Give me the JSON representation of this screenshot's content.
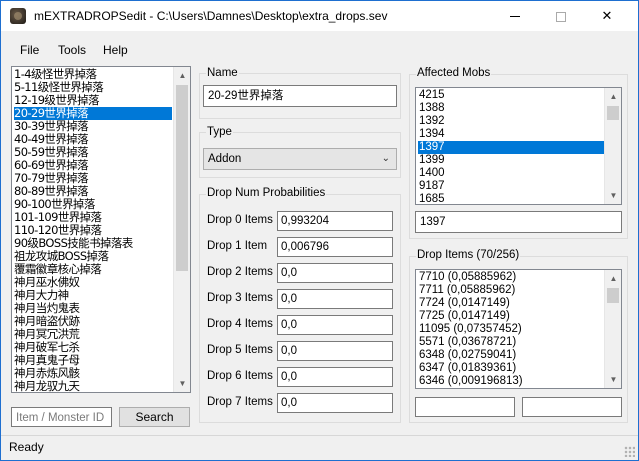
{
  "window": {
    "title": "mEXTRADROPSedit - C:\\Users\\Damnes\\Desktop\\extra_drops.sev",
    "minimize": "minimize-icon",
    "maximize": "maximize-icon",
    "close": "✕"
  },
  "menu": {
    "file": "File",
    "tools": "Tools",
    "help": "Help"
  },
  "drop_list": {
    "items": [
      "1-4级怪世界掉落",
      "5-11级怪世界掉落",
      "12-19级世界掉落",
      "20-29世界掉落",
      "30-39世界掉落",
      "40-49世界掉落",
      "50-59世界掉落",
      "60-69世界掉落",
      "70-79世界掉落",
      "80-89世界掉落",
      "90-100世界掉落",
      "101-109世界掉落",
      "110-120世界掉落",
      "90级BOSS技能书掉落表",
      "祖龙攻城BOSS掉落",
      "覆霜徽章核心掉落",
      "神月巫水佛奴",
      "神月大力神",
      "神月当灼鬼表",
      "神月暗盗伏跡",
      "神月冥冗洪荒",
      "神月破军七杀",
      "神月真鬼子母",
      "神月赤炼风骸",
      "神月龙驭九天"
    ],
    "selected_index": 3
  },
  "search": {
    "placeholder": "Item / Monster ID",
    "button": "Search"
  },
  "name_group": {
    "label": "Name",
    "value": "20-29世界掉落"
  },
  "type_group": {
    "label": "Type",
    "value": "Addon"
  },
  "probabilities": {
    "label": "Drop Num Probabilities",
    "rows": [
      {
        "label": "Drop 0 Items",
        "value": "0,993204"
      },
      {
        "label": "Drop 1 Item",
        "value": "0,006796"
      },
      {
        "label": "Drop 2 Items",
        "value": "0,0"
      },
      {
        "label": "Drop 3 Items",
        "value": "0,0"
      },
      {
        "label": "Drop 4 Items",
        "value": "0,0"
      },
      {
        "label": "Drop 5 Items",
        "value": "0,0"
      },
      {
        "label": "Drop 6 Items",
        "value": "0,0"
      },
      {
        "label": "Drop 7 Items",
        "value": "0,0"
      }
    ]
  },
  "affected_mobs": {
    "label": "Affected Mobs",
    "items": [
      "4215",
      "1388",
      "1392",
      "1394",
      "1397",
      "1399",
      "1400",
      "9187",
      "1685"
    ],
    "selected_index": 4,
    "input_value": "1397"
  },
  "drop_items": {
    "label": "Drop Items (70/256)",
    "items": [
      "7710 (0,05885962)",
      "7711 (0,05885962)",
      "7724 (0,0147149)",
      "7725 (0,0147149)",
      "11095 (0,07357452)",
      "5571 (0,03678721)",
      "6348 (0,02759041)",
      "6347 (0,01839361)",
      "6346 (0,009196813)"
    ],
    "input_id": "",
    "input_prob": ""
  },
  "status": {
    "text": "Ready"
  },
  "colors": {
    "selection": "#0078d7",
    "border_accent": "#1e6fd0"
  }
}
